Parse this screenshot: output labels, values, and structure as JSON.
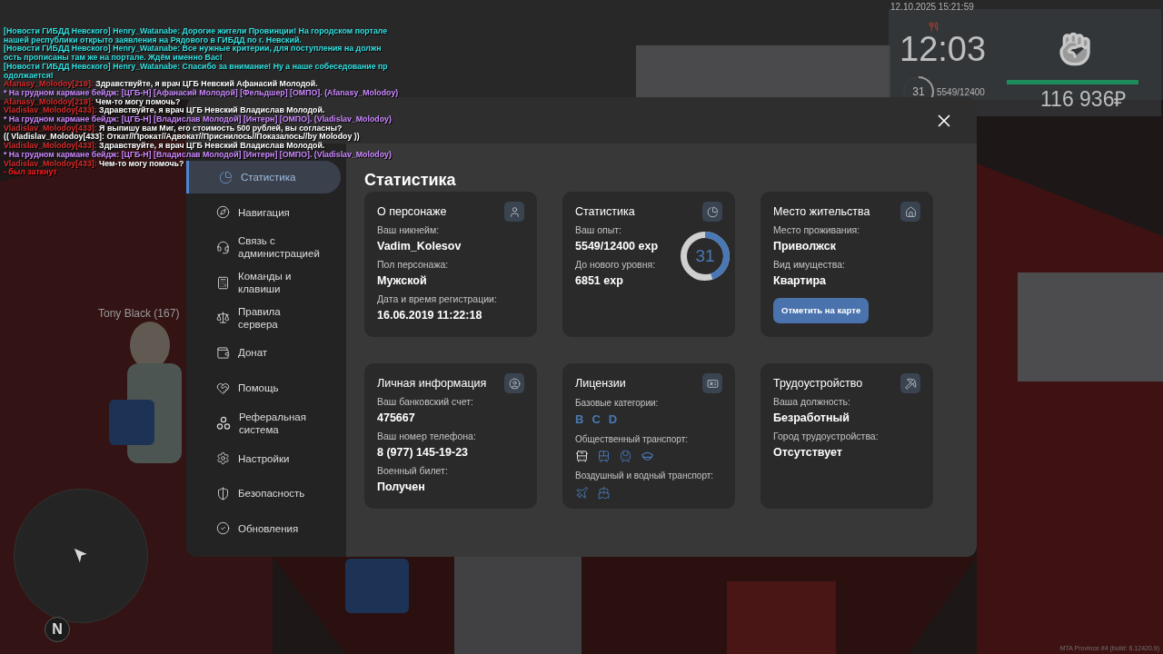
{
  "chat": [
    {
      "segments": [
        {
          "text": "[Новости ГИБДД Невского] Henry_Watanabe: Дорогие жители Провинции! На городском портале",
          "color": "#33e0e0"
        }
      ]
    },
    {
      "segments": [
        {
          "text": "нашей республики открыто заявления на Рядового в ГИБДД по г. Невский.",
          "color": "#33e0e0"
        }
      ]
    },
    {
      "segments": [
        {
          "text": "[Новости ГИБДД Невского] Henry_Watanabe: Все нужные критерии, для поступления на должн",
          "color": "#33e0e0"
        }
      ]
    },
    {
      "segments": [
        {
          "text": "ость прописаны там же на портале. Ждём именно Вас!",
          "color": "#33e0e0"
        }
      ]
    },
    {
      "segments": [
        {
          "text": "[Новости ГИБДД Невского] Henry_Watanabe: Спасибо за внимание! Ну а наше собеседование пр",
          "color": "#33e0e0"
        }
      ]
    },
    {
      "segments": [
        {
          "text": "одолжается!",
          "color": "#33e0e0"
        }
      ]
    },
    {
      "segments": [
        {
          "text": "Afanasy_Molodoy[219]:",
          "color": "#d42a2a"
        },
        {
          "text": "Здравствуйте, я врач ЦГБ Невский Афанасий Молодой.",
          "color": "#ffffff"
        }
      ]
    },
    {
      "segments": [
        {
          "text": "* На грудном кармане бейдж: [ЦГБ-Н] [Афанасий Молодой] [Фельдшер] [ОМПО]. (Afanasy_Molodoy)",
          "color": "#cc88ff"
        }
      ]
    },
    {
      "segments": [
        {
          "text": "Afanasy_Molodoy[219]:",
          "color": "#d42a2a"
        },
        {
          "text": "Чем-то могу помочь?",
          "color": "#ffffff"
        }
      ]
    },
    {
      "segments": [
        {
          "text": "Vladislav_Molodoy[433]:",
          "color": "#d42a2a"
        },
        {
          "text": "Здравствуйте, я врач ЦГБ Невский Владислав Молодой.",
          "color": "#ffffff"
        }
      ]
    },
    {
      "segments": [
        {
          "text": "* На грудном кармане бейдж: [ЦГБ-Н] [Владислав Молодой] [Интерн] [ОМПО]. (Vladislav_Molodoy)",
          "color": "#cc88ff"
        }
      ]
    },
    {
      "segments": [
        {
          "text": "Vladislav_Molodoy[433]:",
          "color": "#d42a2a"
        },
        {
          "text": "Я выпишу вам Миг, его стоимость 500 рублей, вы согласны?",
          "color": "#ffffff"
        }
      ]
    },
    {
      "segments": [
        {
          "text": "(( Vladislav_Molodoy[433]: Откат//Прокат//Адвокат//Приснилось//Показалось//by Molodoy ))",
          "color": "#ffffff"
        }
      ]
    },
    {
      "segments": [
        {
          "text": "Vladislav_Molodoy[433]:",
          "color": "#d42a2a"
        },
        {
          "text": "Здравствуйте, я врач ЦГБ Невский Владислав Молодой.",
          "color": "#ffffff"
        }
      ]
    },
    {
      "segments": [
        {
          "text": "* На грудном кармане бейдж: [ЦГБ-Н] [Владислав Молодой] [Интерн] [ОМПО]. (Vladislav_Molodoy)",
          "color": "#cc88ff"
        }
      ]
    },
    {
      "segments": [
        {
          "text": "Vladislav_Molodoy[433]:",
          "color": "#d42a2a"
        },
        {
          "text": "Чем-то могу помочь?",
          "color": "#ffffff"
        }
      ]
    },
    {
      "segments": [
        {
          "text": "- был заткнут",
          "color": "#ff1a1a"
        }
      ]
    }
  ],
  "hud": {
    "datetime": "12.10.2025 15:21:59",
    "time": "12:03",
    "level": "31",
    "xp": "5549/12400",
    "health": {
      "level": 1
    },
    "money": "116 936₽"
  },
  "nametag": "Tony Black (167)",
  "minimap": {
    "north": "N"
  },
  "build": "MTA Province #4 (build: 6.12420.9)",
  "menu": {
    "sidebar": [
      {
        "label": "Статистика",
        "selected": true
      },
      {
        "label": "Навигация",
        "selected": false
      },
      {
        "label": "Связь с администрацией",
        "selected": false
      },
      {
        "label": "Команды и клавиши",
        "selected": false
      },
      {
        "label": "Правила сервера",
        "selected": false
      },
      {
        "label": "Донат",
        "selected": false
      },
      {
        "label": "Помощь",
        "selected": false
      },
      {
        "label": "Реферальная система",
        "selected": false
      },
      {
        "label": "Настройки",
        "selected": false
      },
      {
        "label": "Безопасность",
        "selected": false
      },
      {
        "label": "Обновления",
        "selected": false
      }
    ],
    "heading": "Статистика",
    "cards": [
      {
        "kind": "fields",
        "title": "О персонаже",
        "fields": [
          {
            "label": "Ваш никнейм:",
            "value": "Vadim_Kolesov"
          },
          {
            "label": "Пол персонажа:",
            "value": "Мужской"
          },
          {
            "label": "Дата и время регистрации:",
            "value": "16.06.2019 11:22:18"
          }
        ]
      },
      {
        "kind": "stats",
        "title": "Статистика",
        "fields": [
          {
            "label": "Ваш опыт:",
            "value": "5549/12400 exp"
          },
          {
            "label": "До нового уровня:",
            "value": "6851 exp"
          }
        ],
        "ring": {
          "text": "31",
          "level": 0.447
        }
      },
      {
        "kind": "fields",
        "title": "Место жительства",
        "fields": [
          {
            "label": "Место проживания:",
            "value": "Приволжск"
          },
          {
            "label": "Вид имущества:",
            "value": "Квартира"
          }
        ],
        "button": "Отметить на карте"
      },
      {
        "kind": "fields",
        "title": "Личная информация",
        "fields": [
          {
            "label": "Ваш банковский счет:",
            "value": "475667"
          },
          {
            "label": "Ваш номер телефона:",
            "value": "8 (977) 145-19-23"
          },
          {
            "label": "Военный билет:",
            "value": "Получен"
          }
        ]
      },
      {
        "kind": "licenses",
        "title": "Лицензии",
        "groups": [
          {
            "label": "Базовые категории:",
            "kind": "letters",
            "items": [
              {
                "text": "B",
                "owned": true
              },
              {
                "text": "C",
                "owned": true
              },
              {
                "text": "D",
                "owned": true
              }
            ]
          },
          {
            "label": "Общественный транспорт:",
            "kind": "icons",
            "items": [
              {
                "kind": "trolleybus",
                "owned": false
              },
              {
                "kind": "bus",
                "owned": true
              },
              {
                "kind": "train",
                "owned": true
              },
              {
                "kind": "cap",
                "owned": true
              }
            ]
          },
          {
            "label": "Воздушный и водный транспорт:",
            "kind": "icons",
            "items": [
              {
                "kind": "plane",
                "owned": true
              },
              {
                "kind": "ship",
                "owned": true
              }
            ]
          }
        ]
      },
      {
        "kind": "fields",
        "title": "Трудоустройство",
        "fields": [
          {
            "label": "Ваша должность:",
            "value": "Безработный"
          },
          {
            "label": "Город трудоустройства:",
            "value": "Отсутствует"
          }
        ]
      }
    ]
  }
}
